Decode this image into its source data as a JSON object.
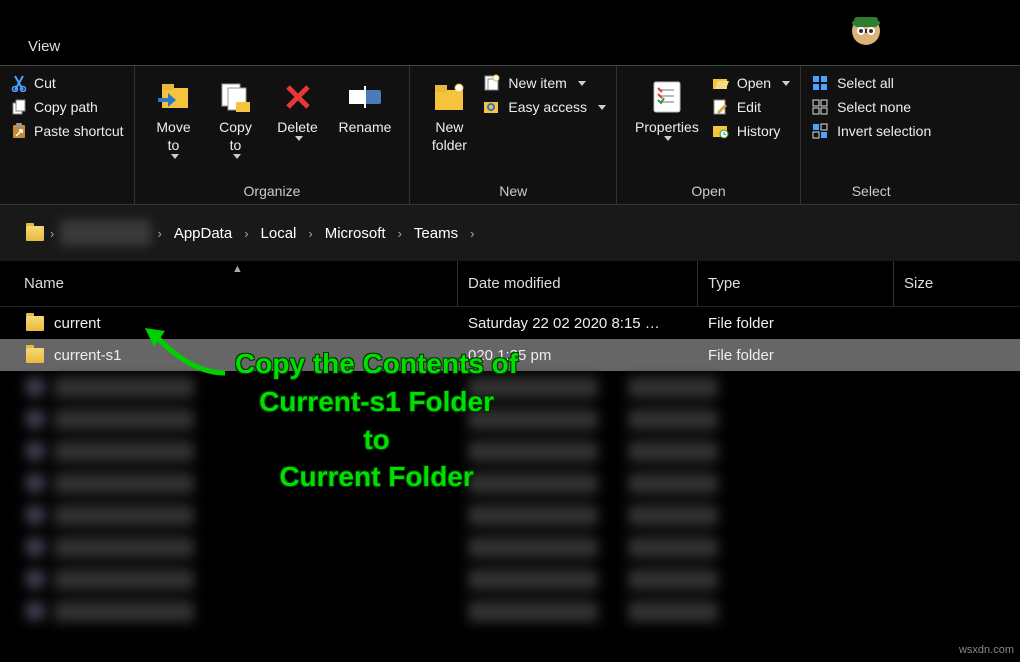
{
  "titlebar": {
    "view": "View"
  },
  "ribbon": {
    "clipboard": {
      "cut": "Cut",
      "copy_path": "Copy path",
      "paste_shortcut": "Paste shortcut"
    },
    "organize": {
      "label": "Organize",
      "move_to": "Move\nto",
      "copy_to": "Copy\nto",
      "delete": "Delete",
      "rename": "Rename"
    },
    "new": {
      "label": "New",
      "new_folder": "New\nfolder",
      "new_item": "New item",
      "easy_access": "Easy access"
    },
    "open": {
      "label": "Open",
      "properties": "Properties",
      "open": "Open",
      "edit": "Edit",
      "history": "History"
    },
    "select": {
      "label": "Select",
      "select_all": "Select all",
      "select_none": "Select none",
      "invert": "Invert selection"
    }
  },
  "breadcrumb": {
    "items": [
      "",
      "AppData",
      "Local",
      "Microsoft",
      "Teams"
    ]
  },
  "columns": {
    "name": "Name",
    "date": "Date modified",
    "type": "Type",
    "size": "Size"
  },
  "rows": [
    {
      "name": "current",
      "date": "Saturday 22 02 2020 8:15 …",
      "type": "File folder",
      "selected": false
    },
    {
      "name": "current-s1",
      "date": "020 1:35 pm",
      "type": "File folder",
      "selected": true
    }
  ],
  "annotation": {
    "line1": "Copy the Contents of",
    "line2": "Current-s1 Folder",
    "line3": "to",
    "line4": "Current Folder"
  },
  "watermark": "wsxdn.com"
}
